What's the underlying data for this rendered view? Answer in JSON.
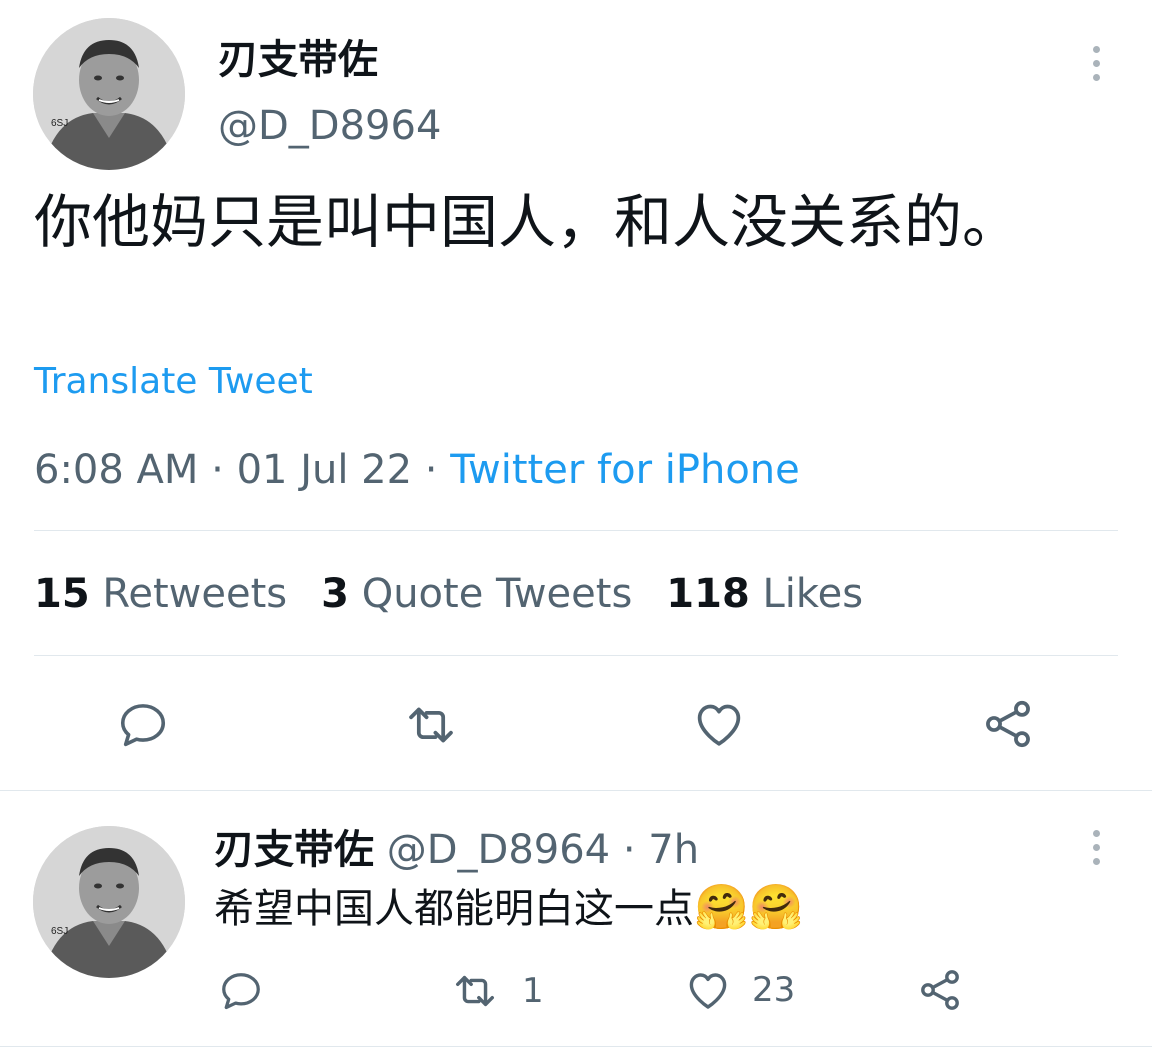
{
  "main_tweet": {
    "display_name": "刃支带佐",
    "handle": "@D_D8964",
    "text": "你他妈只是叫中国人，和人没关系的。",
    "translate_label": "Translate Tweet",
    "time": "6:08 AM",
    "date": "01 Jul 22",
    "source": "Twitter for iPhone",
    "stats": [
      {
        "count": "15",
        "label": "Retweets"
      },
      {
        "count": "3",
        "label": "Quote Tweets"
      },
      {
        "count": "118",
        "label": "Likes"
      }
    ],
    "actions": [
      {
        "icon": "reply-icon"
      },
      {
        "icon": "retweet-icon"
      },
      {
        "icon": "like-icon"
      },
      {
        "icon": "share-icon"
      }
    ]
  },
  "reply": {
    "display_name": "刃支带佐",
    "handle": "@D_D8964",
    "separator": "·",
    "time": "7h",
    "text": "希望中国人都能明白这一点",
    "emojis": [
      "🤗",
      "🤗"
    ],
    "actions": [
      {
        "icon": "reply-icon",
        "count": ""
      },
      {
        "icon": "retweet-icon",
        "count": "1"
      },
      {
        "icon": "like-icon",
        "count": "23"
      },
      {
        "icon": "share-icon",
        "count": ""
      }
    ]
  },
  "colors": {
    "link": "#1d9bf0",
    "secondary_text": "#536471",
    "primary_text": "#0f1419",
    "icon": "#536471",
    "divider": "#e1e8ed"
  }
}
